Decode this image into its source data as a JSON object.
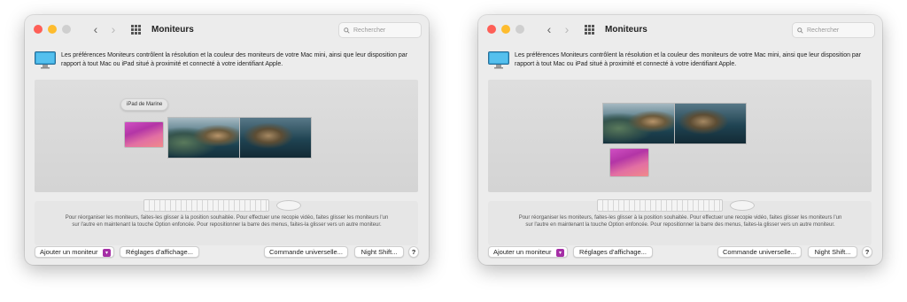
{
  "window": {
    "title": "Moniteurs",
    "search_placeholder": "Rechercher",
    "nav_back": "‹",
    "nav_forward": "›"
  },
  "description": "Les préférences Moniteurs contrôlent la résolution et la couleur des moniteurs de votre Mac mini, ainsi que leur disposition par rapport à tout Mac ou iPad situé à proximité et connecté à votre identifiant Apple.",
  "ipad_tooltip": "iPad de Marine",
  "hint": "Pour réorganiser les moniteurs, faites-les glisser à la position souhaitée. Pour effectuer une recopie vidéo, faites glisser les moniteurs l'un sur l'autre en maintenant la touche Option enfoncée. Pour repositionner la barre des menus, faites-la glisser vers un autre moniteur.",
  "buttons": {
    "add_monitor": "Ajouter un moniteur",
    "display_settings": "Réglages d'affichage...",
    "universal_control": "Commande universelle...",
    "night_shift": "Night Shift...",
    "help": "?"
  },
  "icons": {
    "add_dropdown": "chevron-down-icon",
    "search": "magnifier-icon",
    "app_grid": "grid-icon",
    "monitor": "monitor-icon"
  },
  "colors": {
    "close": "#fe5f57",
    "minimize": "#febc2e",
    "zoom_inactive": "#cfcfcf",
    "dropdown_accent": "#a52fa6"
  }
}
